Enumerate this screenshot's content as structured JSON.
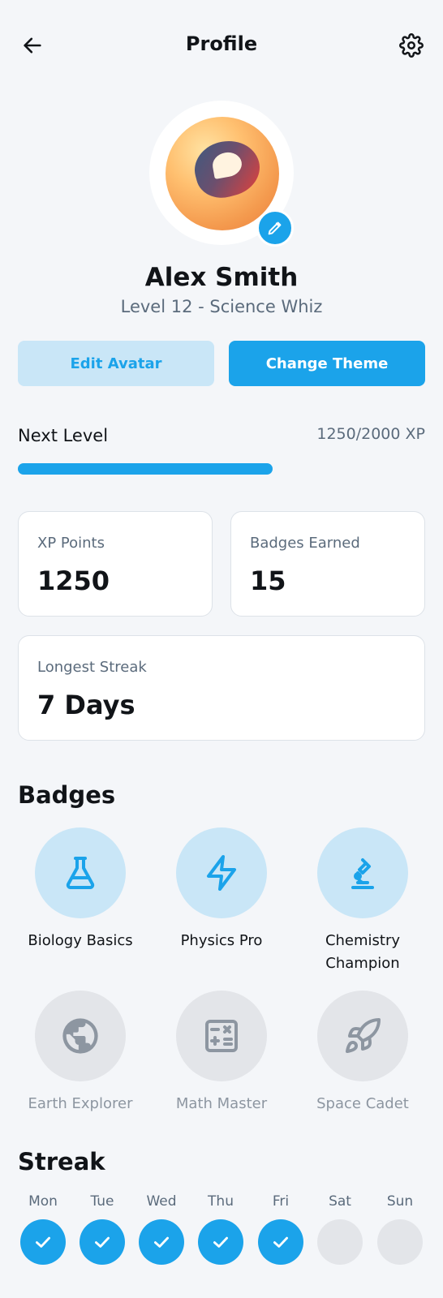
{
  "header": {
    "title": "Profile",
    "back_icon": "arrow-left-icon",
    "settings_icon": "gear-icon"
  },
  "profile": {
    "name": "Alex Smith",
    "level_text": "Level 12 - Science Whiz",
    "avatar_icon": "speech-bubble-avatar",
    "edit_icon": "pencil-icon"
  },
  "actions": {
    "edit_avatar": "Edit Avatar",
    "change_theme": "Change Theme"
  },
  "progress": {
    "label": "Next Level",
    "xp_text": "1250/2000 XP",
    "fraction": 0.625
  },
  "stats": {
    "xp_label": "XP Points",
    "xp_value": "1250",
    "badges_label": "Badges Earned",
    "badges_value": "15",
    "streak_label": "Longest Streak",
    "streak_value": "7 Days"
  },
  "badges": {
    "title": "Badges",
    "items": [
      {
        "label": "Biology Basics",
        "icon": "flask-icon",
        "earned": true
      },
      {
        "label": "Physics Pro",
        "icon": "lightning-icon",
        "earned": true
      },
      {
        "label": "Chemistry Champion",
        "icon": "microscope-icon",
        "earned": true
      },
      {
        "label": "Earth Explorer",
        "icon": "globe-icon",
        "earned": false
      },
      {
        "label": "Math Master",
        "icon": "calculator-icon",
        "earned": false
      },
      {
        "label": "Space Cadet",
        "icon": "rocket-icon",
        "earned": false
      }
    ]
  },
  "streak": {
    "title": "Streak",
    "days": [
      {
        "label": "Mon",
        "done": true
      },
      {
        "label": "Tue",
        "done": true
      },
      {
        "label": "Wed",
        "done": true
      },
      {
        "label": "Thu",
        "done": true
      },
      {
        "label": "Fri",
        "done": true
      },
      {
        "label": "Sat",
        "done": false
      },
      {
        "label": "Sun",
        "done": false
      }
    ]
  },
  "colors": {
    "accent": "#1ba3ea",
    "accent_light": "#c9e6f7",
    "muted": "#5b6b7c",
    "locked": "#e3e5e9"
  }
}
